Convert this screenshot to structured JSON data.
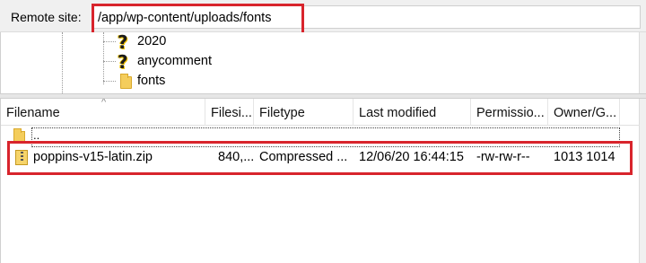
{
  "remote_site": {
    "label": "Remote site:",
    "path": "/app/wp-content/uploads/fonts"
  },
  "tree": {
    "items": [
      {
        "label": "2020",
        "icon": "question-folder-icon"
      },
      {
        "label": "anycomment",
        "icon": "question-folder-icon"
      },
      {
        "label": "fonts",
        "icon": "folder-icon"
      }
    ]
  },
  "file_list": {
    "columns": [
      "Filename",
      "Filesi...",
      "Filetype",
      "Last modified",
      "Permissio...",
      "Owner/G..."
    ],
    "parent_row": {
      "label": ".."
    },
    "rows": [
      {
        "filename": "poppins-v15-latin.zip",
        "filesize": "840,...",
        "filetype": "Compressed ...",
        "last_modified": "12/06/20 16:44:15",
        "permissions": "-rw-rw-r--",
        "owner_group": "1013 1014"
      }
    ]
  },
  "colors": {
    "highlight": "#d8242c",
    "folder": "#f4cd5c"
  }
}
